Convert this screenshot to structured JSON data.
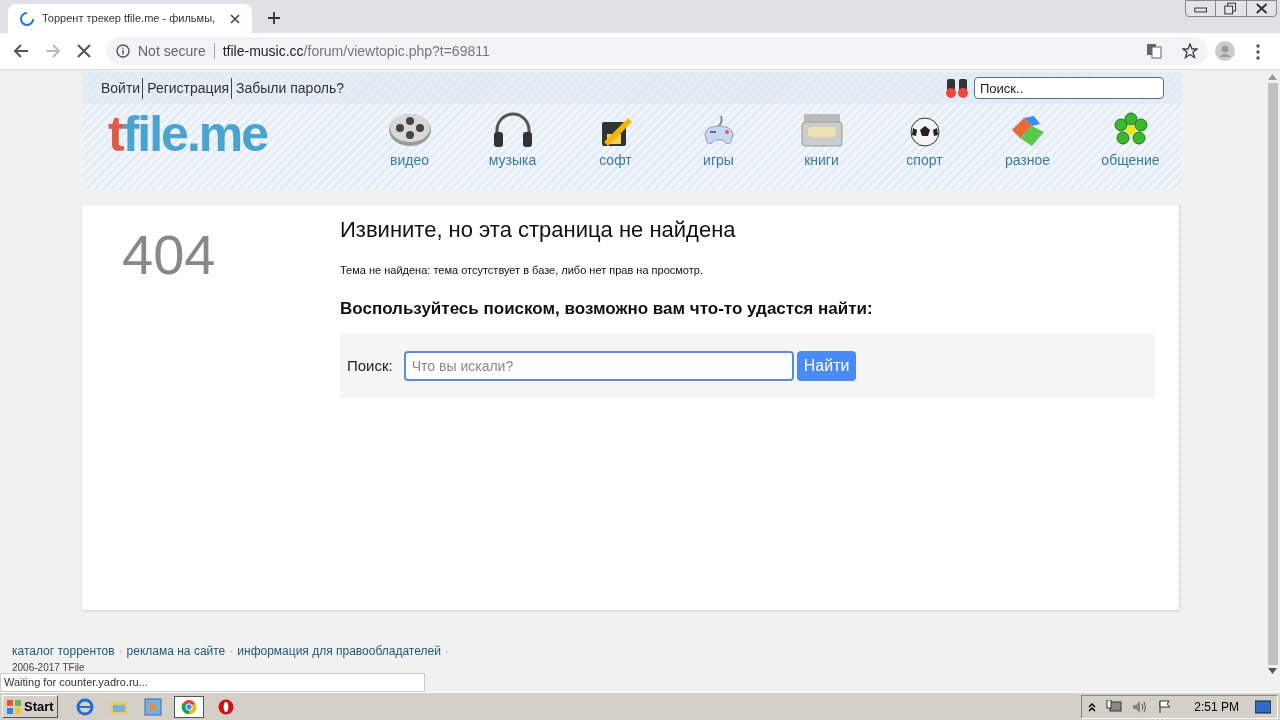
{
  "browser": {
    "tab": {
      "title": "Торрент трекер tfile.me - фильмы,",
      "loading": true
    },
    "address": {
      "security": "Not secure",
      "host": "tfile-music.cc",
      "path": "/forum/viewtopic.php?t=69811"
    }
  },
  "site": {
    "auth_links": [
      "Войти",
      "Регистрация",
      "Забыли пароль?"
    ],
    "search": {
      "placeholder": "Поиск.."
    },
    "logo": {
      "accent": "t",
      "rest": "file.me"
    },
    "categories": [
      {
        "label": "видео"
      },
      {
        "label": "музыка"
      },
      {
        "label": "софт"
      },
      {
        "label": "игры"
      },
      {
        "label": "книги"
      },
      {
        "label": "спорт"
      },
      {
        "label": "разное"
      },
      {
        "label": "общение"
      }
    ]
  },
  "error": {
    "code": "404",
    "title": "Извините, но эта страница не найдена",
    "message": "Тема не найдена: тема отсутствует в базе, либо нет прав на просмотр.",
    "prompt": "Воспользуйтесь поиском, возможно вам что-то удастся найти:",
    "search_label": "Поиск:",
    "search_placeholder": "Что вы искали?",
    "search_button": "Найти"
  },
  "footer": {
    "separator": "·",
    "links": [
      "каталог торрентов",
      "реклама на сайте",
      "информация для правообладателей"
    ],
    "copyright": "2006-2017 TFile"
  },
  "status_bar": "Waiting for counter.yadro.ru...",
  "taskbar": {
    "start": "Start",
    "clock": "2:51 PM"
  }
}
